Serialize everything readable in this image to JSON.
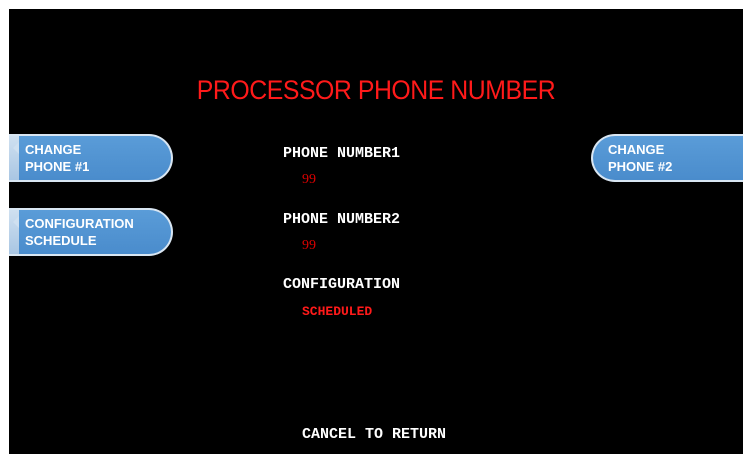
{
  "screen": {
    "title": "PROCESSOR PHONE NUMBER",
    "background_color": "#000000",
    "title_color": "#ff1a1a",
    "button_color": "#4a8ccc"
  },
  "buttons": {
    "change_phone_1": {
      "line1": "CHANGE",
      "line2": "PHONE #1"
    },
    "configuration_schedule": {
      "line1": "CONFIGURATION",
      "line2": "SCHEDULE"
    },
    "change_phone_2": {
      "line1": "CHANGE",
      "line2": "PHONE #2"
    }
  },
  "fields": {
    "phone_number1": {
      "label": "PHONE NUMBER1",
      "value": "99"
    },
    "phone_number2": {
      "label": "PHONE NUMBER2",
      "value": "99"
    },
    "configuration": {
      "label": "CONFIGURATION",
      "value": "SCHEDULED"
    }
  },
  "footer": {
    "cancel_text": "CANCEL TO RETURN"
  }
}
